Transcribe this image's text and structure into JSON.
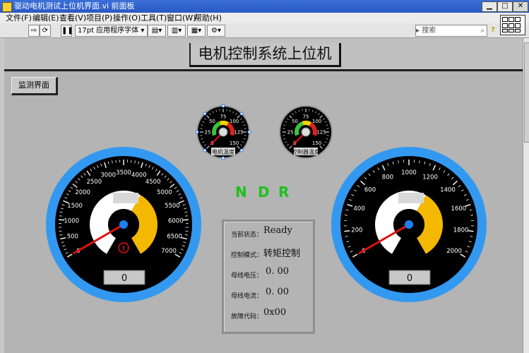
{
  "window": {
    "title": "驱动电机测试上位机界面.vi 前面板",
    "controls": {
      "minimize": "▁",
      "maximize": "□",
      "close": "✕"
    }
  },
  "menu": [
    "文件(F)",
    "编辑(E)",
    "查看(V)",
    "项目(P)",
    "操作(O)",
    "工具(T)",
    "窗口(W)",
    "帮助(H)"
  ],
  "toolbar": {
    "font_select": "17pt 应用程序字体",
    "search_placeholder": "搜索",
    "help_icon": "?"
  },
  "panel": {
    "title": "电机控制系统上位机",
    "monitor_button": "监测界面",
    "ndr": [
      "N",
      "D",
      "R"
    ],
    "status": [
      {
        "label": "当前状态：",
        "value": "Ready"
      },
      {
        "label": "控制模式：",
        "value": "转矩控制"
      },
      {
        "label": "母线电压：",
        "value": "0. 00"
      },
      {
        "label": "母线电流：",
        "value": "0. 00"
      },
      {
        "label": "故障代码：",
        "value": "0x00"
      }
    ]
  },
  "gauges": {
    "motor_temp": {
      "label": "电机温度",
      "ticks": [
        "0",
        "25",
        "50",
        "75",
        "100",
        "125",
        "150"
      ],
      "value": 0
    },
    "controller_temp": {
      "label": "控制器温度",
      "ticks": [
        "0",
        "25",
        "50",
        "75",
        "100",
        "125",
        "150"
      ],
      "value": 0
    },
    "speed": {
      "ticks": [
        "0",
        "500",
        "1000",
        "1500",
        "2000",
        "2500",
        "3000",
        "3500",
        "4000",
        "4500",
        "5000",
        "5500",
        "6000",
        "6500",
        "7000"
      ],
      "readout": "0",
      "value": 0,
      "warning_icon": "!"
    },
    "torque": {
      "ticks": [
        "0",
        "200",
        "400",
        "600",
        "800",
        "1000",
        "1200",
        "1400",
        "1600",
        "1800",
        "2000"
      ],
      "readout": "0",
      "value": 0
    }
  },
  "colors": {
    "bezel": "#3399f0",
    "needle": "#e01010",
    "ndr_green": "#1fbf1f",
    "gauge_yellow": "#f5b800",
    "gauge_white": "#ffffff"
  }
}
